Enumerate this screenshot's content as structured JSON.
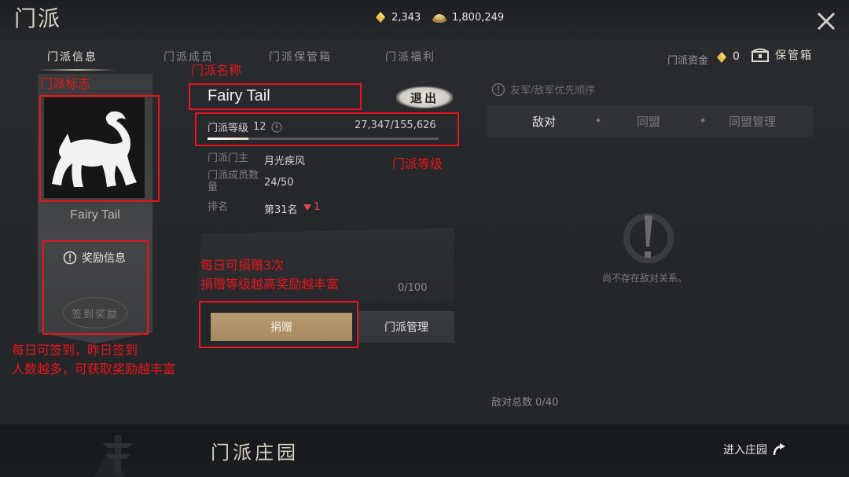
{
  "header": {
    "title": "门派",
    "currency_gold": "2,343",
    "currency_coins": "1,800,249"
  },
  "tabs": [
    "门派信息",
    "门派成员",
    "门派保管箱",
    "门派福利"
  ],
  "header_right": {
    "fund_label": "门派资金",
    "fund_value": "0",
    "vault_label": "保管箱"
  },
  "left": {
    "clan_name": "Fairy Tail",
    "reward_info_label": "奖励信息",
    "signin_reward_label": "签到奖励"
  },
  "info": {
    "clan_name": "Fairy Tail",
    "exit_label": "退出",
    "level_label": "门派等级",
    "level_value": "12",
    "exp_current": "27,347",
    "exp_total": "155,626",
    "exp_progress": 0.176,
    "leader_label": "门派门主",
    "leader_value": "月光疾风",
    "members_label": "门派成员数量",
    "members_value": "24/50",
    "rank_label": "排名",
    "rank_value": "第31名",
    "rank_change": "1"
  },
  "donate": {
    "count": "0/100",
    "donate_label": "捐赠",
    "manage_label": "门派管理"
  },
  "relations": {
    "priority_note": "友军/敌军优先顺序",
    "tabs": [
      "敌对",
      "同盟",
      "同盟管理"
    ],
    "empty_text": "尚不存在敌对关系。",
    "total_label": "敌对总数",
    "total_value": "0/40"
  },
  "bottom": {
    "manor_title": "门派庄园",
    "enter_label": "进入庄园"
  },
  "annotations": {
    "emblem": "门派标志",
    "clan_name": "门派名称",
    "level": "门派等级",
    "donate_line1": "每日可捐赠3次",
    "donate_line2": "捐赠等级越高奖励越丰富",
    "signin_line1": "每日可签到，昨日签到",
    "signin_line2": "人数越多，可获取奖励越丰富"
  },
  "colors": {
    "annotation_red": "#e8161b",
    "donate_gold": "#b89b72"
  }
}
